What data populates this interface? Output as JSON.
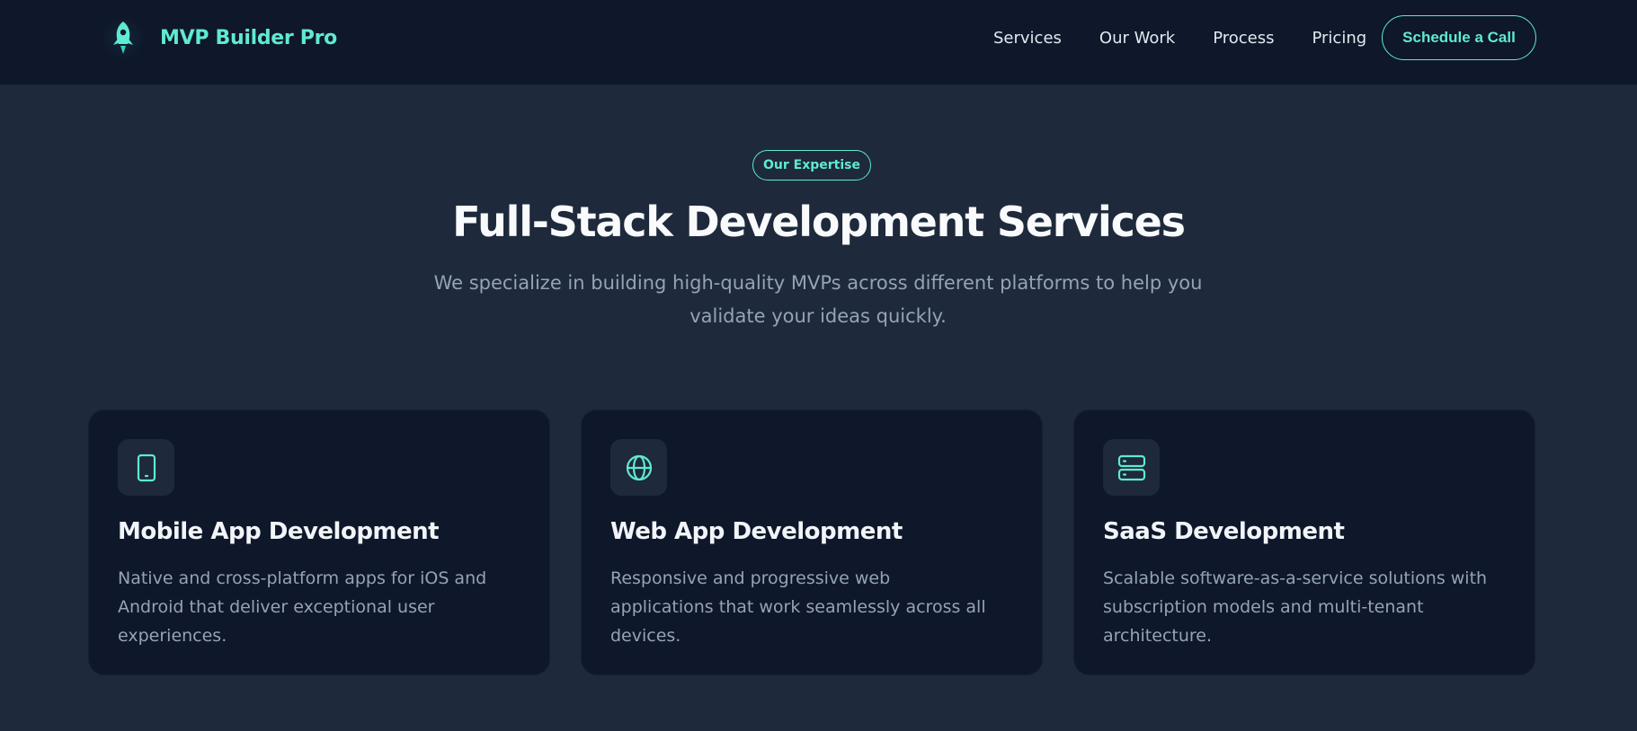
{
  "header": {
    "brand_name": "MVP Builder Pro",
    "brand_icon": "rocket-icon",
    "nav": [
      {
        "label": "Services"
      },
      {
        "label": "Our Work"
      },
      {
        "label": "Process"
      },
      {
        "label": "Pricing"
      }
    ],
    "cta_label": "Schedule a Call"
  },
  "hero": {
    "badge": "Our Expertise",
    "title": "Full-Stack Development Services",
    "subtitle": "We specialize in building high-quality MVPs across different platforms to help you validate your ideas quickly."
  },
  "services": [
    {
      "icon": "mobile-phone-icon",
      "title": "Mobile App Development",
      "description": "Native and cross-platform apps for iOS and Android that deliver exceptional user experiences."
    },
    {
      "icon": "globe-icon",
      "title": "Web App Development",
      "description": "Responsive and progressive web applications that work seamlessly across all devices."
    },
    {
      "icon": "server-icon",
      "title": "SaaS Development",
      "description": "Scalable software-as-a-service solutions with subscription models and multi-tenant architecture."
    }
  ],
  "colors": {
    "accent": "#5eead4",
    "background": "#1e293b",
    "header_background": "#0f172a",
    "card_background": "#0f172a",
    "muted_text": "#94a3b8"
  }
}
